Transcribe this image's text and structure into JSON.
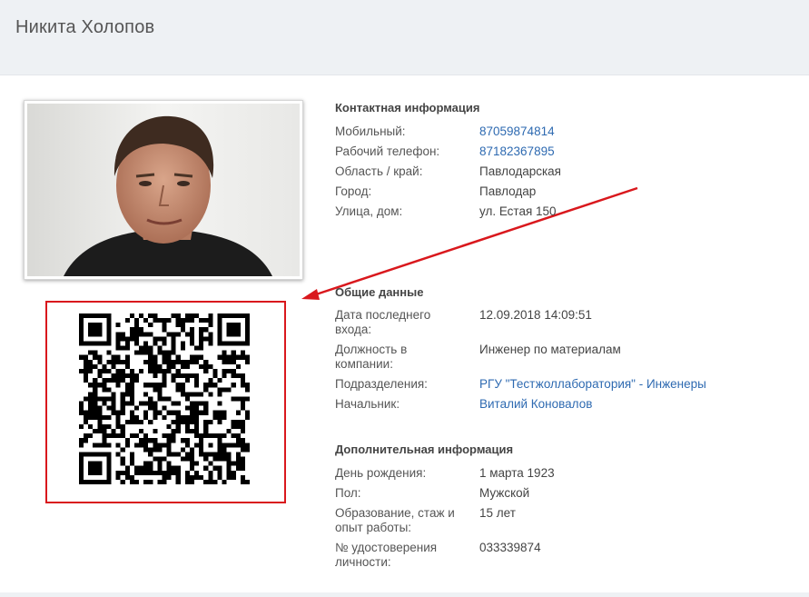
{
  "header": {
    "title": "Никита Холопов"
  },
  "contact": {
    "title": "Контактная информация",
    "rows": [
      {
        "label": "Мобильный:",
        "value": "87059874814"
      },
      {
        "label": "Рабочий телефон:",
        "value": "87182367895"
      },
      {
        "label": "Область / край:",
        "value": "Павлодарская"
      },
      {
        "label": "Город:",
        "value": "Павлодар"
      },
      {
        "label": "Улица, дом:",
        "value": "ул. Естая 150"
      }
    ]
  },
  "general": {
    "title": "Общие данные",
    "rows": [
      {
        "label": "Дата последнего входа:",
        "value": "12.09.2018 14:09:51"
      },
      {
        "label": "Должность в компании:",
        "value": "Инженер по материалам"
      },
      {
        "label": "Подразделения:",
        "value": "РГУ \"Тестжоллаборатория\" - Инженеры"
      },
      {
        "label": "Начальник:",
        "value": "Виталий Коновалов"
      }
    ]
  },
  "extra": {
    "title": "Дополнительная информация",
    "rows": [
      {
        "label": "День рождения:",
        "value": "1 марта 1923"
      },
      {
        "label": "Пол:",
        "value": "Мужской"
      },
      {
        "label": "Образование, стаж и опыт работы:",
        "value": "15 лет"
      },
      {
        "label": "№ удостоверения личности:",
        "value": "033339874"
      }
    ]
  },
  "colors": {
    "annotation": "#d9181d",
    "link": "#2e6ab1"
  },
  "icons": {
    "qr": "qr-code-icon",
    "photo": "profile-photo"
  }
}
